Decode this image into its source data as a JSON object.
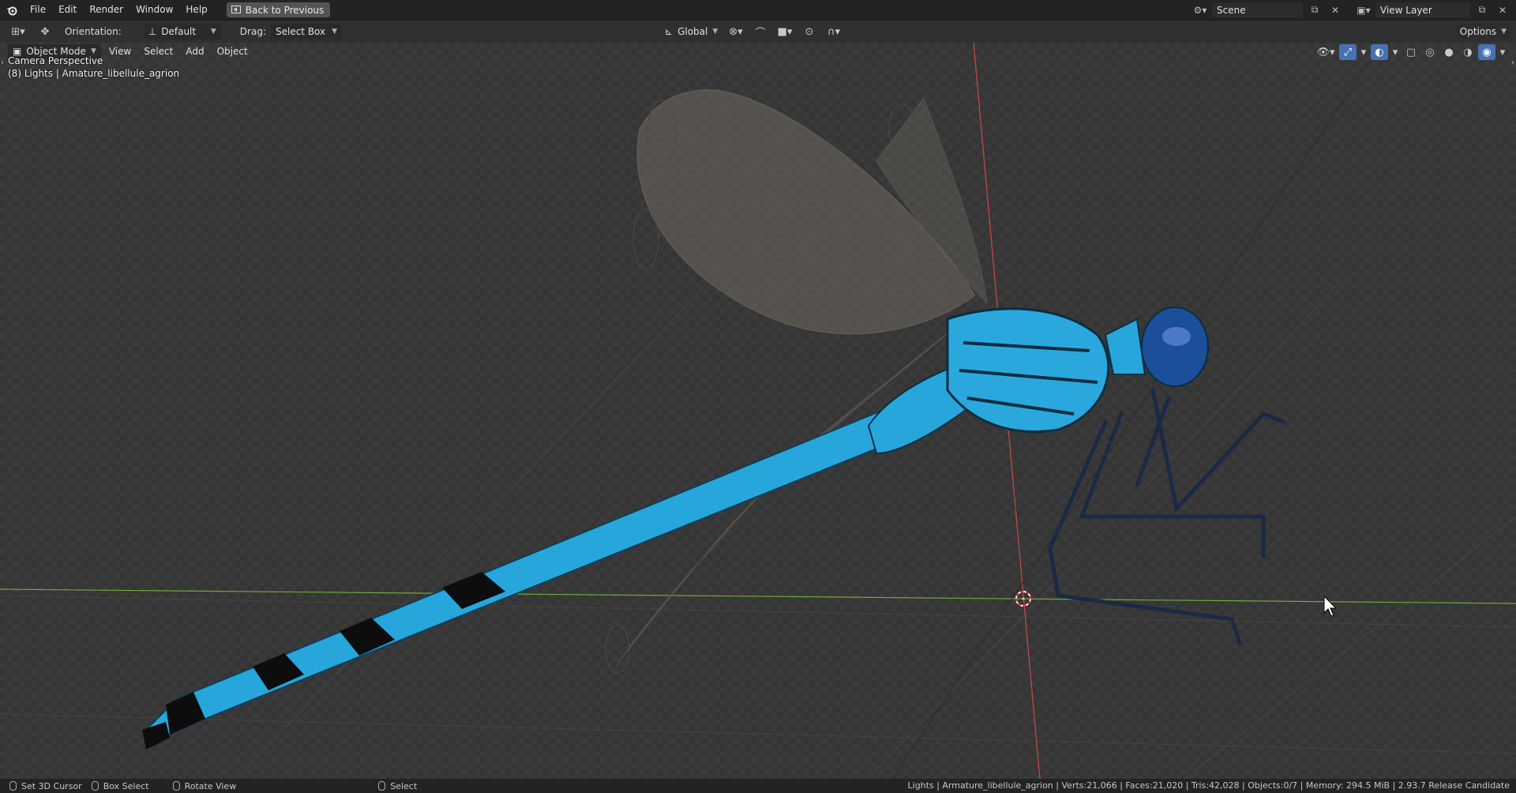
{
  "menubar": {
    "items": [
      "File",
      "Edit",
      "Render",
      "Window",
      "Help"
    ],
    "back_button": "Back to Previous",
    "scene_label": "Scene",
    "view_layer_label": "View Layer"
  },
  "toolheader": {
    "orientation_label": "Orientation:",
    "orientation_value": "Default",
    "drag_label": "Drag:",
    "drag_value": "Select Box",
    "transform_space": "Global",
    "options_label": "Options"
  },
  "viewport": {
    "mode": "Object Mode",
    "menus": [
      "View",
      "Select",
      "Add",
      "Object"
    ],
    "overlay_line1": "Camera Perspective",
    "overlay_line2": "(8) Lights | Amature_libellule_agrion"
  },
  "statusbar": {
    "hints": [
      {
        "label": "Set 3D Cursor"
      },
      {
        "label": "Box Select"
      },
      {
        "label": "Rotate View"
      },
      {
        "label": "Select"
      }
    ],
    "info": "Lights | Armature_libellule_agrion | Verts:21,066 | Faces:21,020 | Tris:42,028 | Objects:0/7 | Memory: 294.5 MiB | 2.93.7 Release Candidate"
  },
  "colors": {
    "accent": "#4772b3",
    "x_axis": "#c84a4a",
    "y_axis": "#6fa83a",
    "dragonfly_blue": "#27a6dc"
  }
}
